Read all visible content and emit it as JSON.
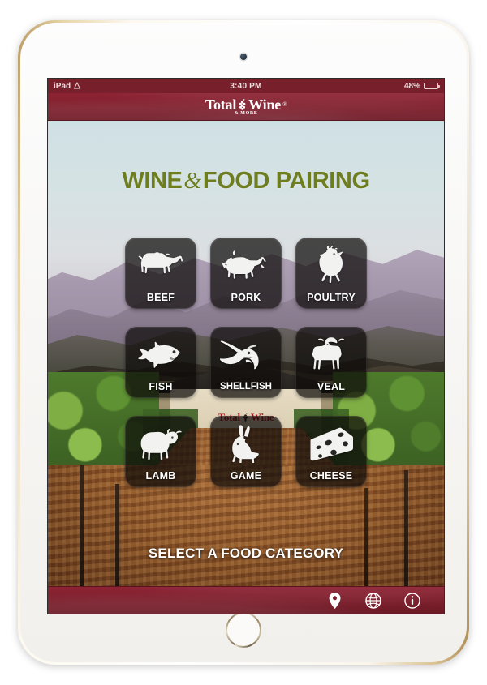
{
  "device": {
    "type": "ipad",
    "camera": "front-camera",
    "home_button": "home-button"
  },
  "status_bar": {
    "device_label": "iPad",
    "wifi_icon": "wifi-icon",
    "time": "3:40 PM",
    "battery_percent": "48%",
    "battery_level": 48,
    "battery_icon": "battery-icon"
  },
  "header": {
    "logo_word1": "Total",
    "logo_word2": "Wine",
    "logo_trademark": "®",
    "logo_subtitle": "& MORE",
    "grape_icon": "grape-cluster-icon",
    "background_color": "#82202e"
  },
  "background": {
    "store_sign_word1": "Total",
    "store_sign_word2": "Wine",
    "store_sign_grape_icon": "grape-cluster-icon",
    "store_sign_color": "#b5121b",
    "scene": "vineyard-with-store"
  },
  "main": {
    "title_part1": "WINE",
    "title_ampersand": "&",
    "title_part2": "FOOD PAIRING",
    "title_color": "#6e7d1e",
    "prompt": "SELECT A FOOD CATEGORY",
    "categories": [
      {
        "label": "BEEF",
        "icon": "cow-icon"
      },
      {
        "label": "PORK",
        "icon": "pig-icon"
      },
      {
        "label": "POULTRY",
        "icon": "chicken-icon"
      },
      {
        "label": "FISH",
        "icon": "fish-icon"
      },
      {
        "label": "SHELLFISH",
        "icon": "shrimp-icon"
      },
      {
        "label": "VEAL",
        "icon": "calf-icon"
      },
      {
        "label": "LAMB",
        "icon": "sheep-icon"
      },
      {
        "label": "GAME",
        "icon": "rabbit-icon"
      },
      {
        "label": "CHEESE",
        "icon": "cheese-icon"
      }
    ]
  },
  "toolbar": {
    "background_color": "#7d1f2d",
    "buttons": [
      {
        "name": "store-locator-button",
        "icon": "location-pin-icon"
      },
      {
        "name": "website-button",
        "icon": "globe-icon"
      },
      {
        "name": "info-button",
        "icon": "info-circle-icon"
      }
    ]
  }
}
